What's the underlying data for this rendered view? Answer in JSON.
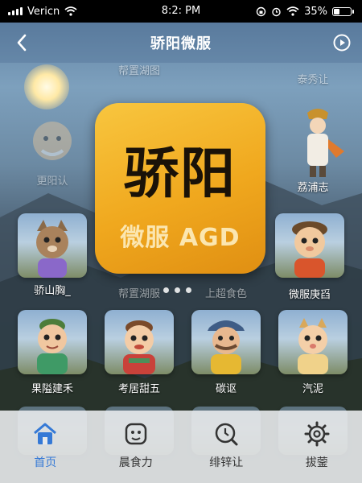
{
  "status_bar": {
    "carrier": "Vericn",
    "time": "8:2: PM",
    "battery": "35%",
    "battery_level": 0.35
  },
  "navbar": {
    "title": "骄阳微服"
  },
  "logo": {
    "line1": "骄阳",
    "line2": "微服 AGD"
  },
  "characters": {
    "top_labels": [
      "更阳认",
      "荔浦志"
    ],
    "row0_partial": [
      "帮置湖图",
      "泰秀让"
    ],
    "row1": [
      "骄山胸_",
      "帮置湖服",
      "上超食色",
      "微服庚舀"
    ],
    "row2": [
      "果隘建禾",
      "考居甜五",
      "碳讴",
      "汽泥"
    ]
  },
  "carousel": {
    "pages": 3,
    "active_index": 0
  },
  "tabbar": {
    "items": [
      {
        "label": "首页",
        "icon": "home-icon",
        "active": true
      },
      {
        "label": "晨食力",
        "icon": "face-icon",
        "active": false
      },
      {
        "label": "绯锌让",
        "icon": "clock-search-icon",
        "active": false
      },
      {
        "label": "拔蓥",
        "icon": "gear-icon",
        "active": false
      }
    ]
  },
  "colors": {
    "accent": "#3579d6",
    "logo_bg": "#f0a81e",
    "tabbar_bg": "#e8eaec"
  }
}
